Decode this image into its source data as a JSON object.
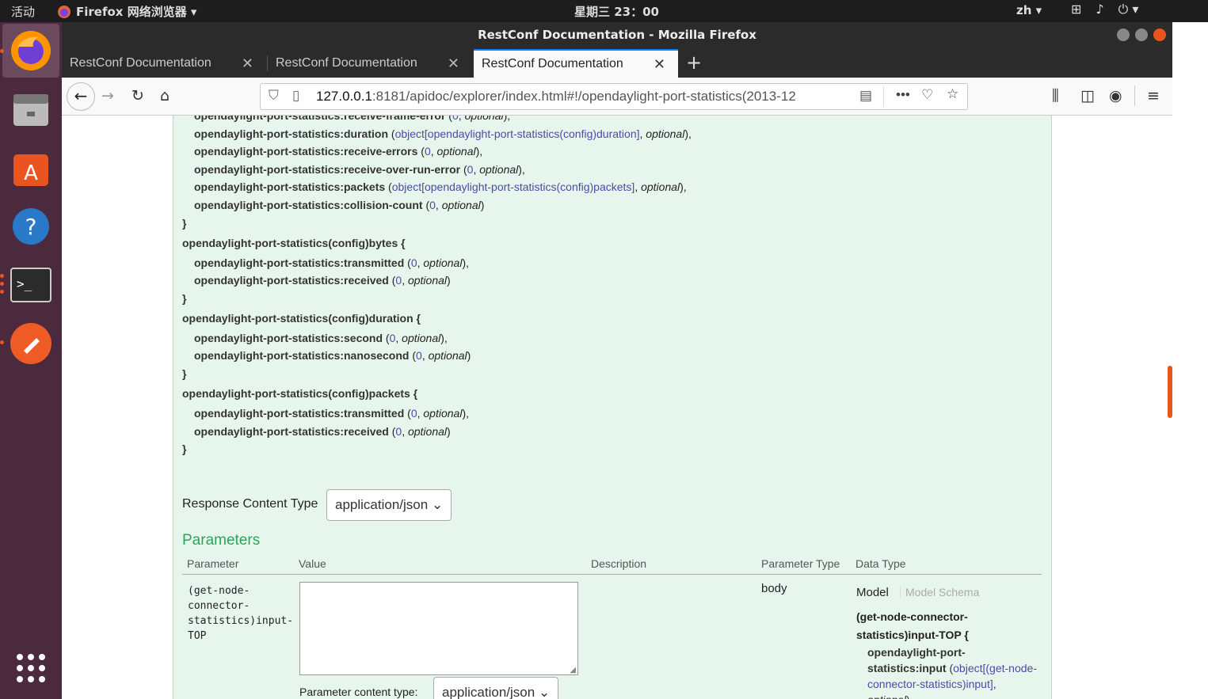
{
  "topbar": {
    "activities": "活动",
    "app_menu": "Firefox 网络浏览器 ▾",
    "clock": "星期三 23：00",
    "lang": "zh ▾"
  },
  "window": {
    "title": "RestConf Documentation - Mozilla Firefox"
  },
  "tabs": [
    {
      "label": "RestConf Documentation"
    },
    {
      "label": "RestConf Documentation"
    },
    {
      "label": "RestConf Documentation"
    }
  ],
  "url": {
    "host": "127.0.0.1",
    "rest": ":8181/apidoc/explorer/index.html#!/opendaylight-port-statistics(2013-12"
  },
  "model_lines": [
    {
      "indent": true,
      "name": "opendaylight-port-statistics:receive-frame-error",
      "pre": " (",
      "type": "0",
      "post": ", ",
      "opt": "optional",
      "end": "),"
    },
    {
      "indent": true,
      "name": "opendaylight-port-statistics:duration",
      "pre": " (",
      "type": "object[opendaylight-port-statistics(config)duration]",
      "post": ", ",
      "opt": "optional",
      "end": "),"
    },
    {
      "indent": true,
      "name": "opendaylight-port-statistics:receive-errors",
      "pre": " (",
      "type": "0",
      "post": ", ",
      "opt": "optional",
      "end": "),"
    },
    {
      "indent": true,
      "name": "opendaylight-port-statistics:receive-over-run-error",
      "pre": " (",
      "type": "0",
      "post": ", ",
      "opt": "optional",
      "end": "),"
    },
    {
      "indent": true,
      "name": "opendaylight-port-statistics:packets",
      "pre": " (",
      "type": "object[opendaylight-port-statistics(config)packets]",
      "post": ", ",
      "opt": "optional",
      "end": "),"
    },
    {
      "indent": true,
      "name": "opendaylight-port-statistics:collision-count",
      "pre": " (",
      "type": "0",
      "post": ", ",
      "opt": "optional",
      "end": ")"
    },
    {
      "indent": false,
      "name": "}",
      "pre": "",
      "type": "",
      "post": "",
      "opt": "",
      "end": ""
    },
    {
      "indent": false,
      "name": "opendaylight-port-statistics(config)bytes {",
      "pre": "",
      "type": "",
      "post": "",
      "opt": "",
      "end": ""
    },
    {
      "indent": true,
      "name": "opendaylight-port-statistics:transmitted",
      "pre": " (",
      "type": "0",
      "post": ", ",
      "opt": "optional",
      "end": "),"
    },
    {
      "indent": true,
      "name": "opendaylight-port-statistics:received",
      "pre": " (",
      "type": "0",
      "post": ", ",
      "opt": "optional",
      "end": ")"
    },
    {
      "indent": false,
      "name": "}",
      "pre": "",
      "type": "",
      "post": "",
      "opt": "",
      "end": ""
    },
    {
      "indent": false,
      "name": "opendaylight-port-statistics(config)duration {",
      "pre": "",
      "type": "",
      "post": "",
      "opt": "",
      "end": ""
    },
    {
      "indent": true,
      "name": "opendaylight-port-statistics:second",
      "pre": " (",
      "type": "0",
      "post": ", ",
      "opt": "optional",
      "end": "),"
    },
    {
      "indent": true,
      "name": "opendaylight-port-statistics:nanosecond",
      "pre": " (",
      "type": "0",
      "post": ", ",
      "opt": "optional",
      "end": ")"
    },
    {
      "indent": false,
      "name": "}",
      "pre": "",
      "type": "",
      "post": "",
      "opt": "",
      "end": ""
    },
    {
      "indent": false,
      "name": "opendaylight-port-statistics(config)packets {",
      "pre": "",
      "type": "",
      "post": "",
      "opt": "",
      "end": ""
    },
    {
      "indent": true,
      "name": "opendaylight-port-statistics:transmitted",
      "pre": " (",
      "type": "0",
      "post": ", ",
      "opt": "optional",
      "end": "),"
    },
    {
      "indent": true,
      "name": "opendaylight-port-statistics:received",
      "pre": " (",
      "type": "0",
      "post": ", ",
      "opt": "optional",
      "end": ")"
    },
    {
      "indent": false,
      "name": "}",
      "pre": "",
      "type": "",
      "post": "",
      "opt": "",
      "end": ""
    }
  ],
  "response": {
    "label": "Response Content Type",
    "value": "application/json"
  },
  "parameters": {
    "title": "Parameters",
    "headers": [
      "Parameter",
      "Value",
      "Description",
      "Parameter Type",
      "Data Type"
    ],
    "row": {
      "name_lines": [
        "(get-node-",
        "connector-",
        "statistics)input-",
        "TOP"
      ],
      "param_type": "body",
      "content_type_label": "Parameter content type:",
      "content_type_value": "application/json",
      "model_tab": "Model",
      "schema_tab": "Model Schema",
      "model_title": "(get-node-connector-statistics)input-TOP {",
      "model_field": "opendaylight-port-statistics:input",
      "model_type": "object[(get-node-connector-statistics)input]",
      "model_opt": "optional"
    }
  },
  "colors": {
    "accent": "#0a84ff",
    "ubuntu_orange": "#e95420",
    "panel_green": "#e7f6ec",
    "param_green": "#2ca45a",
    "link": "#4a4aa8"
  }
}
